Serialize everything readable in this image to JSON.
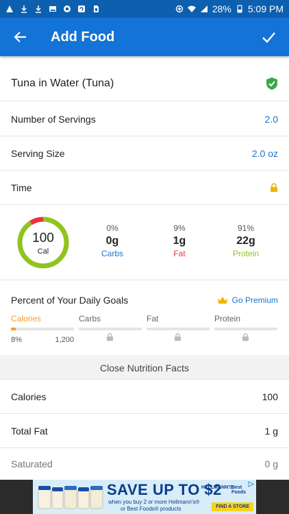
{
  "status_bar": {
    "battery_pct": "28%",
    "time": "5:09 PM"
  },
  "app_bar": {
    "title": "Add Food"
  },
  "food": {
    "name": "Tuna in Water (Tuna)"
  },
  "servings": {
    "label": "Number of Servings",
    "value": "2.0"
  },
  "serving_size": {
    "label": "Serving Size",
    "value": "2.0 oz"
  },
  "time": {
    "label": "Time"
  },
  "calories_ring": {
    "value": "100",
    "unit": "Cal",
    "fractions": {
      "carbs": 0,
      "fat": 0.09,
      "protein": 0.91
    }
  },
  "macros": [
    {
      "pct": "0%",
      "grams": "0g",
      "name": "Carbs",
      "color": "#1a73c9"
    },
    {
      "pct": "9%",
      "grams": "1g",
      "name": "Fat",
      "color": "#e8333c"
    },
    {
      "pct": "91%",
      "grams": "22g",
      "name": "Protein",
      "color": "#8fc41e"
    }
  ],
  "goals": {
    "heading": "Percent of Your Daily Goals",
    "premium_label": "Go Premium",
    "columns": [
      {
        "label": "Calories",
        "percent": "8%",
        "goal": "1,200",
        "fill_fraction": 0.08
      },
      {
        "label": "Carbs"
      },
      {
        "label": "Fat"
      },
      {
        "label": "Protein"
      }
    ]
  },
  "close_facts": {
    "label": "Close Nutrition Facts"
  },
  "nutrition": [
    {
      "label": "Calories",
      "value": "100"
    },
    {
      "label": "Total Fat",
      "value": "1 g"
    },
    {
      "label": "Saturated",
      "value": "0 g"
    }
  ],
  "ad": {
    "headline": "SAVE UP TO $2",
    "line1": "when you buy 2 or more Hellmann's®",
    "line2": "or Best Foods® products",
    "brand1": "HELLMANN'S",
    "brand2": "Best Foods",
    "cta": "FIND A STORE"
  },
  "colors": {
    "status_bar": "#0d5fb0",
    "app_bar": "#1473d6",
    "accent_blue": "#1a73c9",
    "verified_green": "#3aa845",
    "lock_amber": "#f0b400",
    "ring_green": "#8fc41e",
    "ring_red": "#e8333c",
    "calories_orange": "#f4a01c"
  }
}
